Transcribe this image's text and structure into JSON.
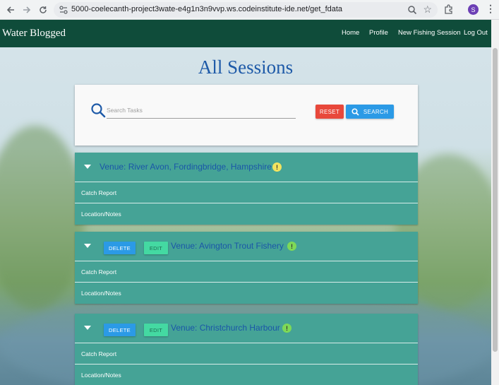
{
  "browser": {
    "url": "5000-coelecanth-project3wate-e4g1n3n9vvp.ws.codeinstitute-ide.net/get_fdata",
    "profile_initial": "S"
  },
  "navbar": {
    "brand": "Water Blogged",
    "links": [
      "Home",
      "Profile",
      "New Fishing Session",
      "Log Out"
    ]
  },
  "page": {
    "title": "All Sessions"
  },
  "search": {
    "placeholder": "Search Tasks",
    "reset_label": "RESET",
    "search_label": "SEARCH"
  },
  "sessions": [
    {
      "venue": "Venue: River Avon, Fordingbridge, Hampshire",
      "indicator": "!",
      "indicator_color": "#f2e35f",
      "has_actions": false,
      "rows": [
        "Catch Report",
        "Location/Notes"
      ]
    },
    {
      "venue": "Venue: Avington Trout Fishery",
      "indicator": "!",
      "indicator_color": "#7ed957",
      "has_actions": true,
      "delete_label": "DELETE",
      "edit_label": "EDIT",
      "rows": [
        "Catch Report",
        "Location/Notes"
      ]
    },
    {
      "venue": "Venue: Christchurch Harbour",
      "indicator": "!",
      "indicator_color": "#7ed957",
      "has_actions": true,
      "delete_label": "DELETE",
      "edit_label": "EDIT",
      "rows": [
        "Catch Report",
        "Location/Notes"
      ]
    }
  ],
  "colors": {
    "navbar": "#0f4c3a",
    "title": "#1e5aa8",
    "session_bg": "#45a396",
    "reset": "#e8483b",
    "search": "#2b9ae6",
    "edit": "#44d9a2"
  }
}
